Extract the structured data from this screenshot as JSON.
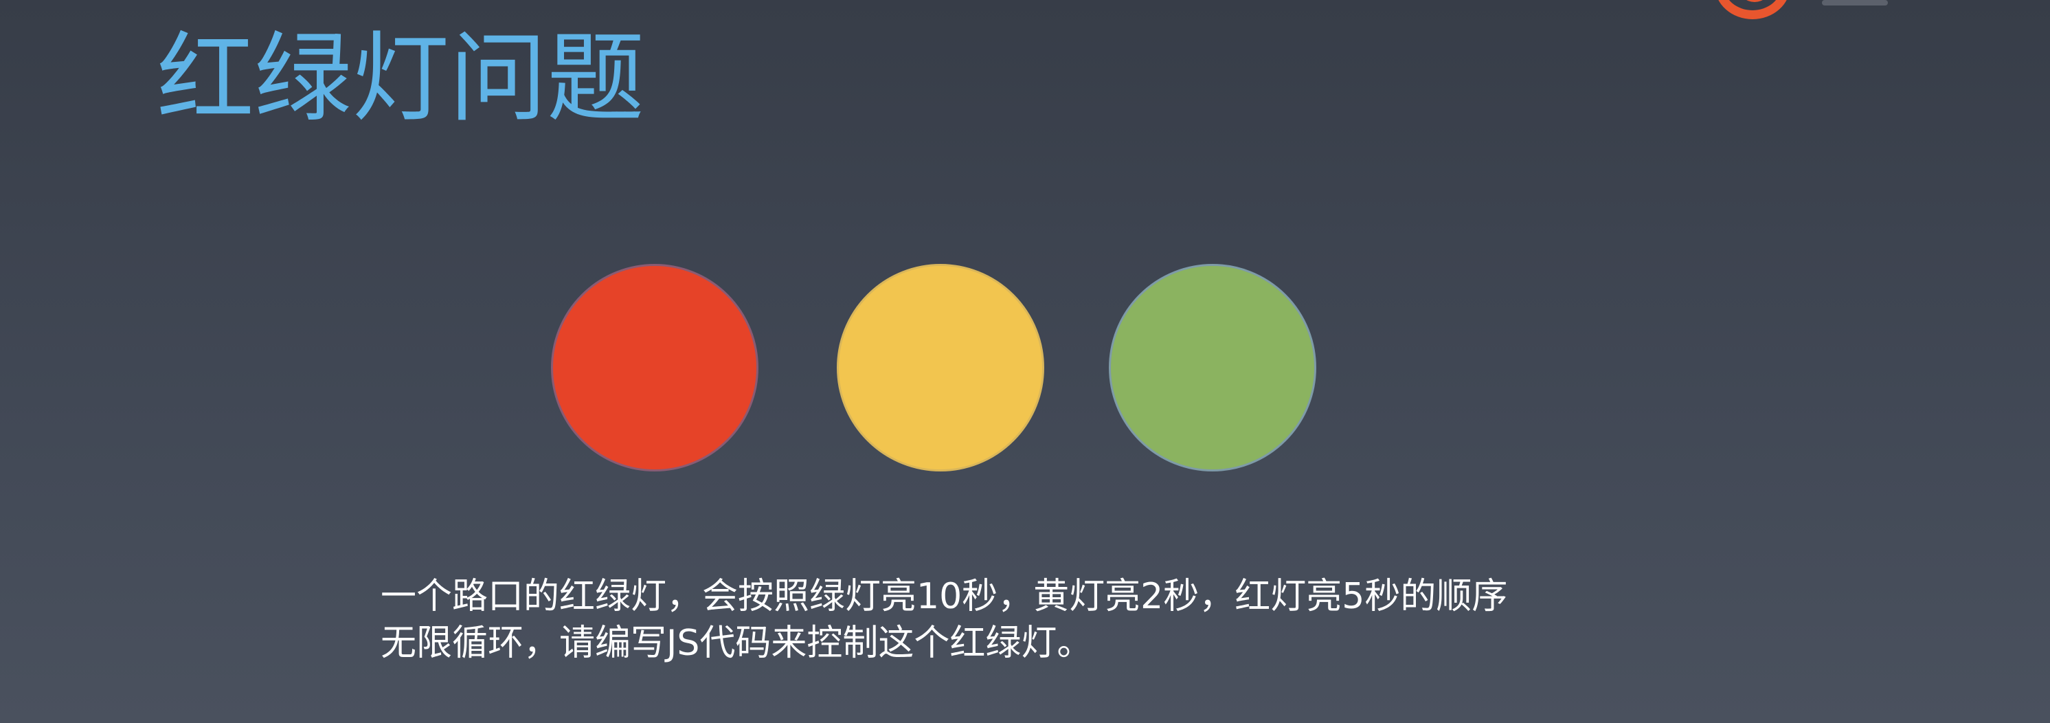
{
  "slide": {
    "title": "红绿灯问题",
    "lights": [
      {
        "name": "red",
        "color": "#e64328"
      },
      {
        "name": "yellow",
        "color": "#f2c54f"
      },
      {
        "name": "green",
        "color": "#8bb360"
      }
    ],
    "description_lines": [
      "一个路口的红绿灯，会按照绿灯亮10秒，黄灯亮2秒，红灯亮5秒的顺序",
      "无限循环，请编写JS代码来控制这个红绿灯。"
    ],
    "logo_icon": "brand-logo-icon",
    "colors": {
      "title": "#5fb3e6",
      "background_top": "#373d48",
      "background_bottom": "#4a515e",
      "logo": "#e8562e"
    }
  }
}
